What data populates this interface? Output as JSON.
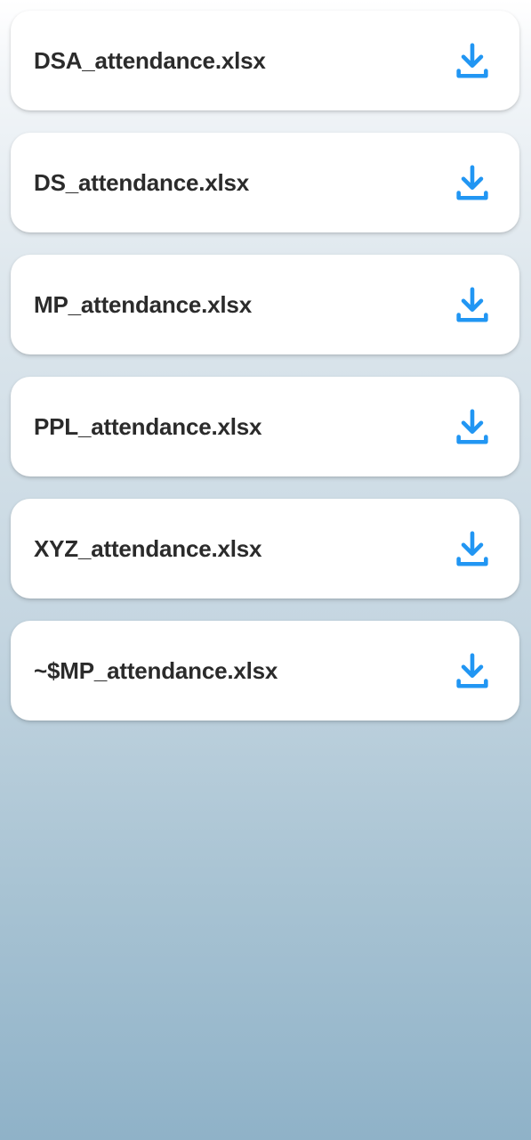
{
  "files": [
    {
      "name": "DSA_attendance.xlsx",
      "icon": "download-icon"
    },
    {
      "name": "DS_attendance.xlsx",
      "icon": "download-icon"
    },
    {
      "name": "MP_attendance.xlsx",
      "icon": "download-icon"
    },
    {
      "name": "PPL_attendance.xlsx",
      "icon": "download-icon"
    },
    {
      "name": "XYZ_attendance.xlsx",
      "icon": "download-icon"
    },
    {
      "name": "~$MP_attendance.xlsx",
      "icon": "download-icon"
    }
  ],
  "colors": {
    "accent": "#2196f3",
    "text": "#2b2b2b",
    "card": "#ffffff"
  }
}
